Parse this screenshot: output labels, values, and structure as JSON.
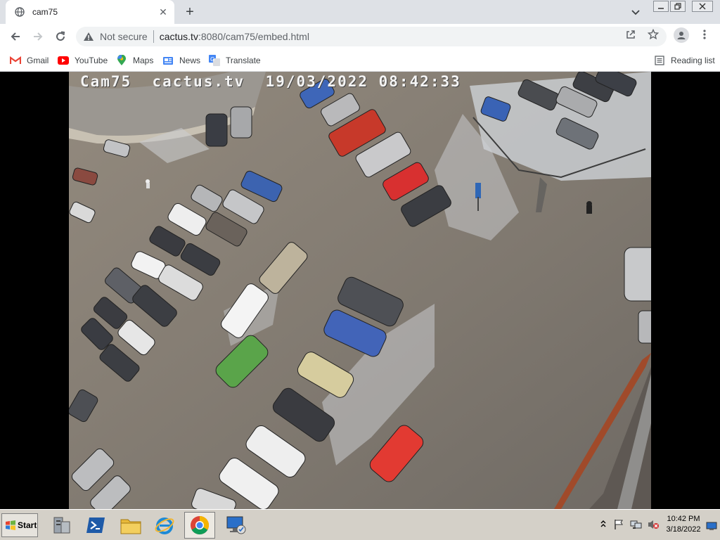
{
  "tab": {
    "title": "cam75",
    "favicon": "globe-icon",
    "close": "close-icon"
  },
  "toolbar": {
    "back": "back-arrow-icon",
    "forward": "forward-arrow-icon",
    "reload": "reload-icon",
    "security_label": "Not secure",
    "url_host": "cactus.tv",
    "url_rest": ":8080/cam75/embed.html"
  },
  "bookmarks": [
    {
      "label": "Gmail",
      "icon": "gmail-icon",
      "color": "#ea4335"
    },
    {
      "label": "YouTube",
      "icon": "youtube-icon",
      "color": "#ff0000"
    },
    {
      "label": "Maps",
      "icon": "maps-icon",
      "color": "#34a853"
    },
    {
      "label": "News",
      "icon": "news-icon",
      "color": "#4285f4"
    },
    {
      "label": "Translate",
      "icon": "translate-icon",
      "color": "#4285f4"
    }
  ],
  "reading_list": {
    "label": "Reading list",
    "icon": "reading-list-icon"
  },
  "camera": {
    "overlay_text": "Cam75  cactus.tv  19/03/2022 08:42:33"
  },
  "taskbar": {
    "start_label": "Start",
    "clock_time": "10:42 PM",
    "clock_date": "3/18/2022"
  }
}
